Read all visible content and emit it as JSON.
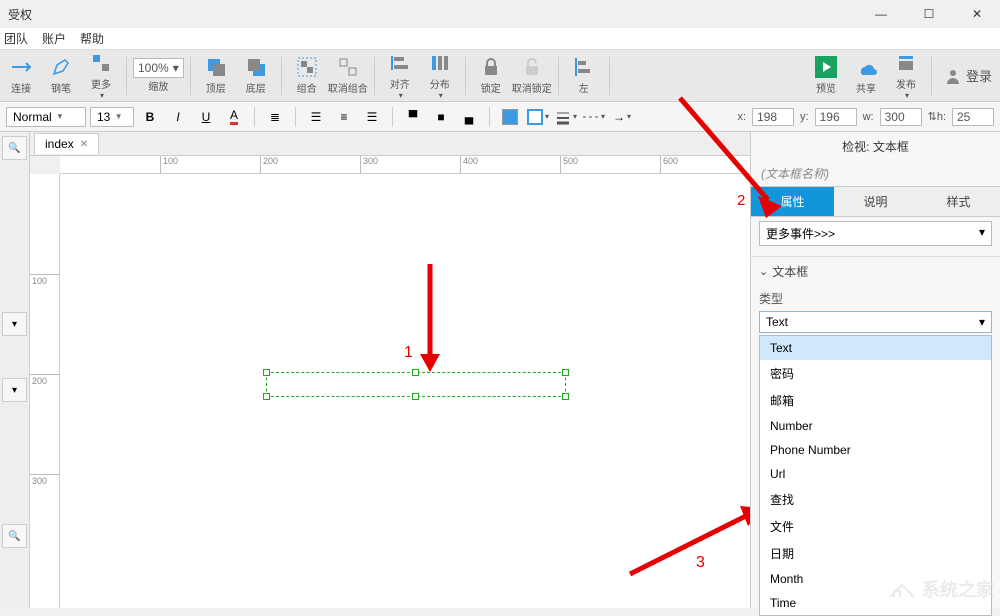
{
  "window": {
    "title": "受权",
    "controls": {
      "min": "—",
      "max": "☐",
      "close": "✕"
    }
  },
  "menu": {
    "team": "团队",
    "account": "账户",
    "help": "帮助"
  },
  "ribbon": {
    "zoom": "100%",
    "items": {
      "connect": "连接",
      "pen": "钢笔",
      "more": "更多",
      "zoom_lbl": "缩放",
      "top": "顶层",
      "bottom": "底层",
      "group": "组合",
      "ungroup": "取消组合",
      "align": "对齐",
      "distribute": "分布",
      "lock": "锁定",
      "unlock": "取消锁定",
      "left_align": "左",
      "preview": "预览",
      "share": "共享",
      "publish": "发布",
      "login": "登录"
    }
  },
  "format": {
    "style": "Normal",
    "font_size": "13",
    "coords": {
      "x_label": "x:",
      "x": "198",
      "y_label": "y:",
      "y": "196",
      "w_label": "w:",
      "w": "300",
      "h_label": "⇅h:",
      "h": "25"
    }
  },
  "tab": {
    "name": "index"
  },
  "ruler": {
    "h": [
      "100",
      "200",
      "300",
      "400",
      "500",
      "600"
    ],
    "v": [
      "100",
      "200",
      "300"
    ]
  },
  "annotations": {
    "n1": "1",
    "n2": "2",
    "n3": "3"
  },
  "panel": {
    "view_title": "检视: 文本框",
    "name_placeholder": "(文本框名称)",
    "tabs": {
      "props": "属性",
      "desc": "说明",
      "style": "样式"
    },
    "more_events": "更多事件>>>",
    "section": "文本框",
    "type_label": "类型",
    "type_value": "Text",
    "options": [
      "Text",
      "密码",
      "邮箱",
      "Number",
      "Phone Number",
      "Url",
      "查找",
      "文件",
      "日期",
      "Month",
      "Time"
    ]
  },
  "watermark": "系统之家"
}
